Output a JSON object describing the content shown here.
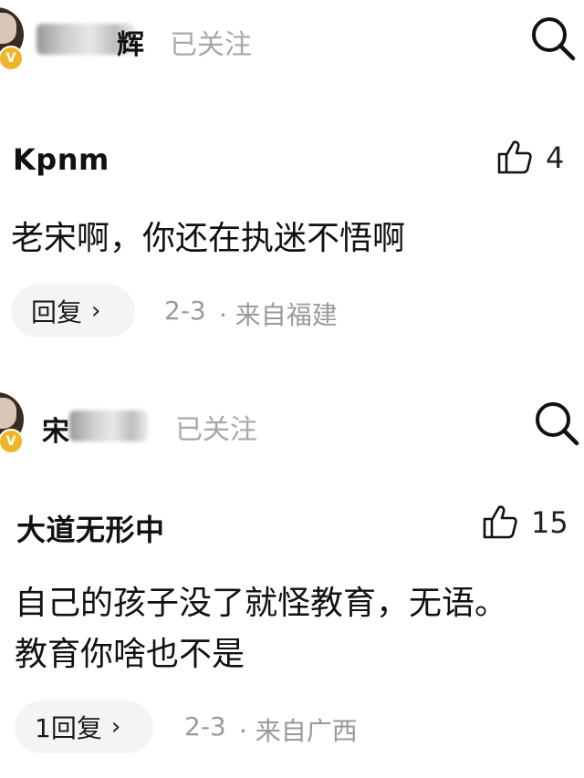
{
  "posts": [
    {
      "author_visible": "辉",
      "follow_label": "已关注",
      "badge": "V",
      "comment": {
        "nickname": "Kpnm",
        "likes": "4",
        "content_lines": [
          "老宋啊，你还在执迷不悟啊"
        ],
        "reply_label": "回复",
        "date": "2-3",
        "location": "· 来自福建"
      }
    },
    {
      "author_visible": "宋",
      "follow_label": "已关注",
      "badge": "V",
      "comment": {
        "nickname": "大道无形中",
        "likes": "15",
        "content_lines": [
          "自己的孩子没了就怪教育，无语。",
          "教育你啥也不是"
        ],
        "reply_label": "1回复",
        "date": "2-3",
        "location": "· 来自广西"
      }
    }
  ],
  "icons": {
    "search": "search-icon",
    "like": "thumbs-up-icon",
    "chevron": "chevron-right-icon",
    "verified": "verified-badge-icon"
  },
  "colors": {
    "badge": "#f0b429",
    "muted": "#9a9a9a",
    "pill": "#f4f4f4"
  }
}
